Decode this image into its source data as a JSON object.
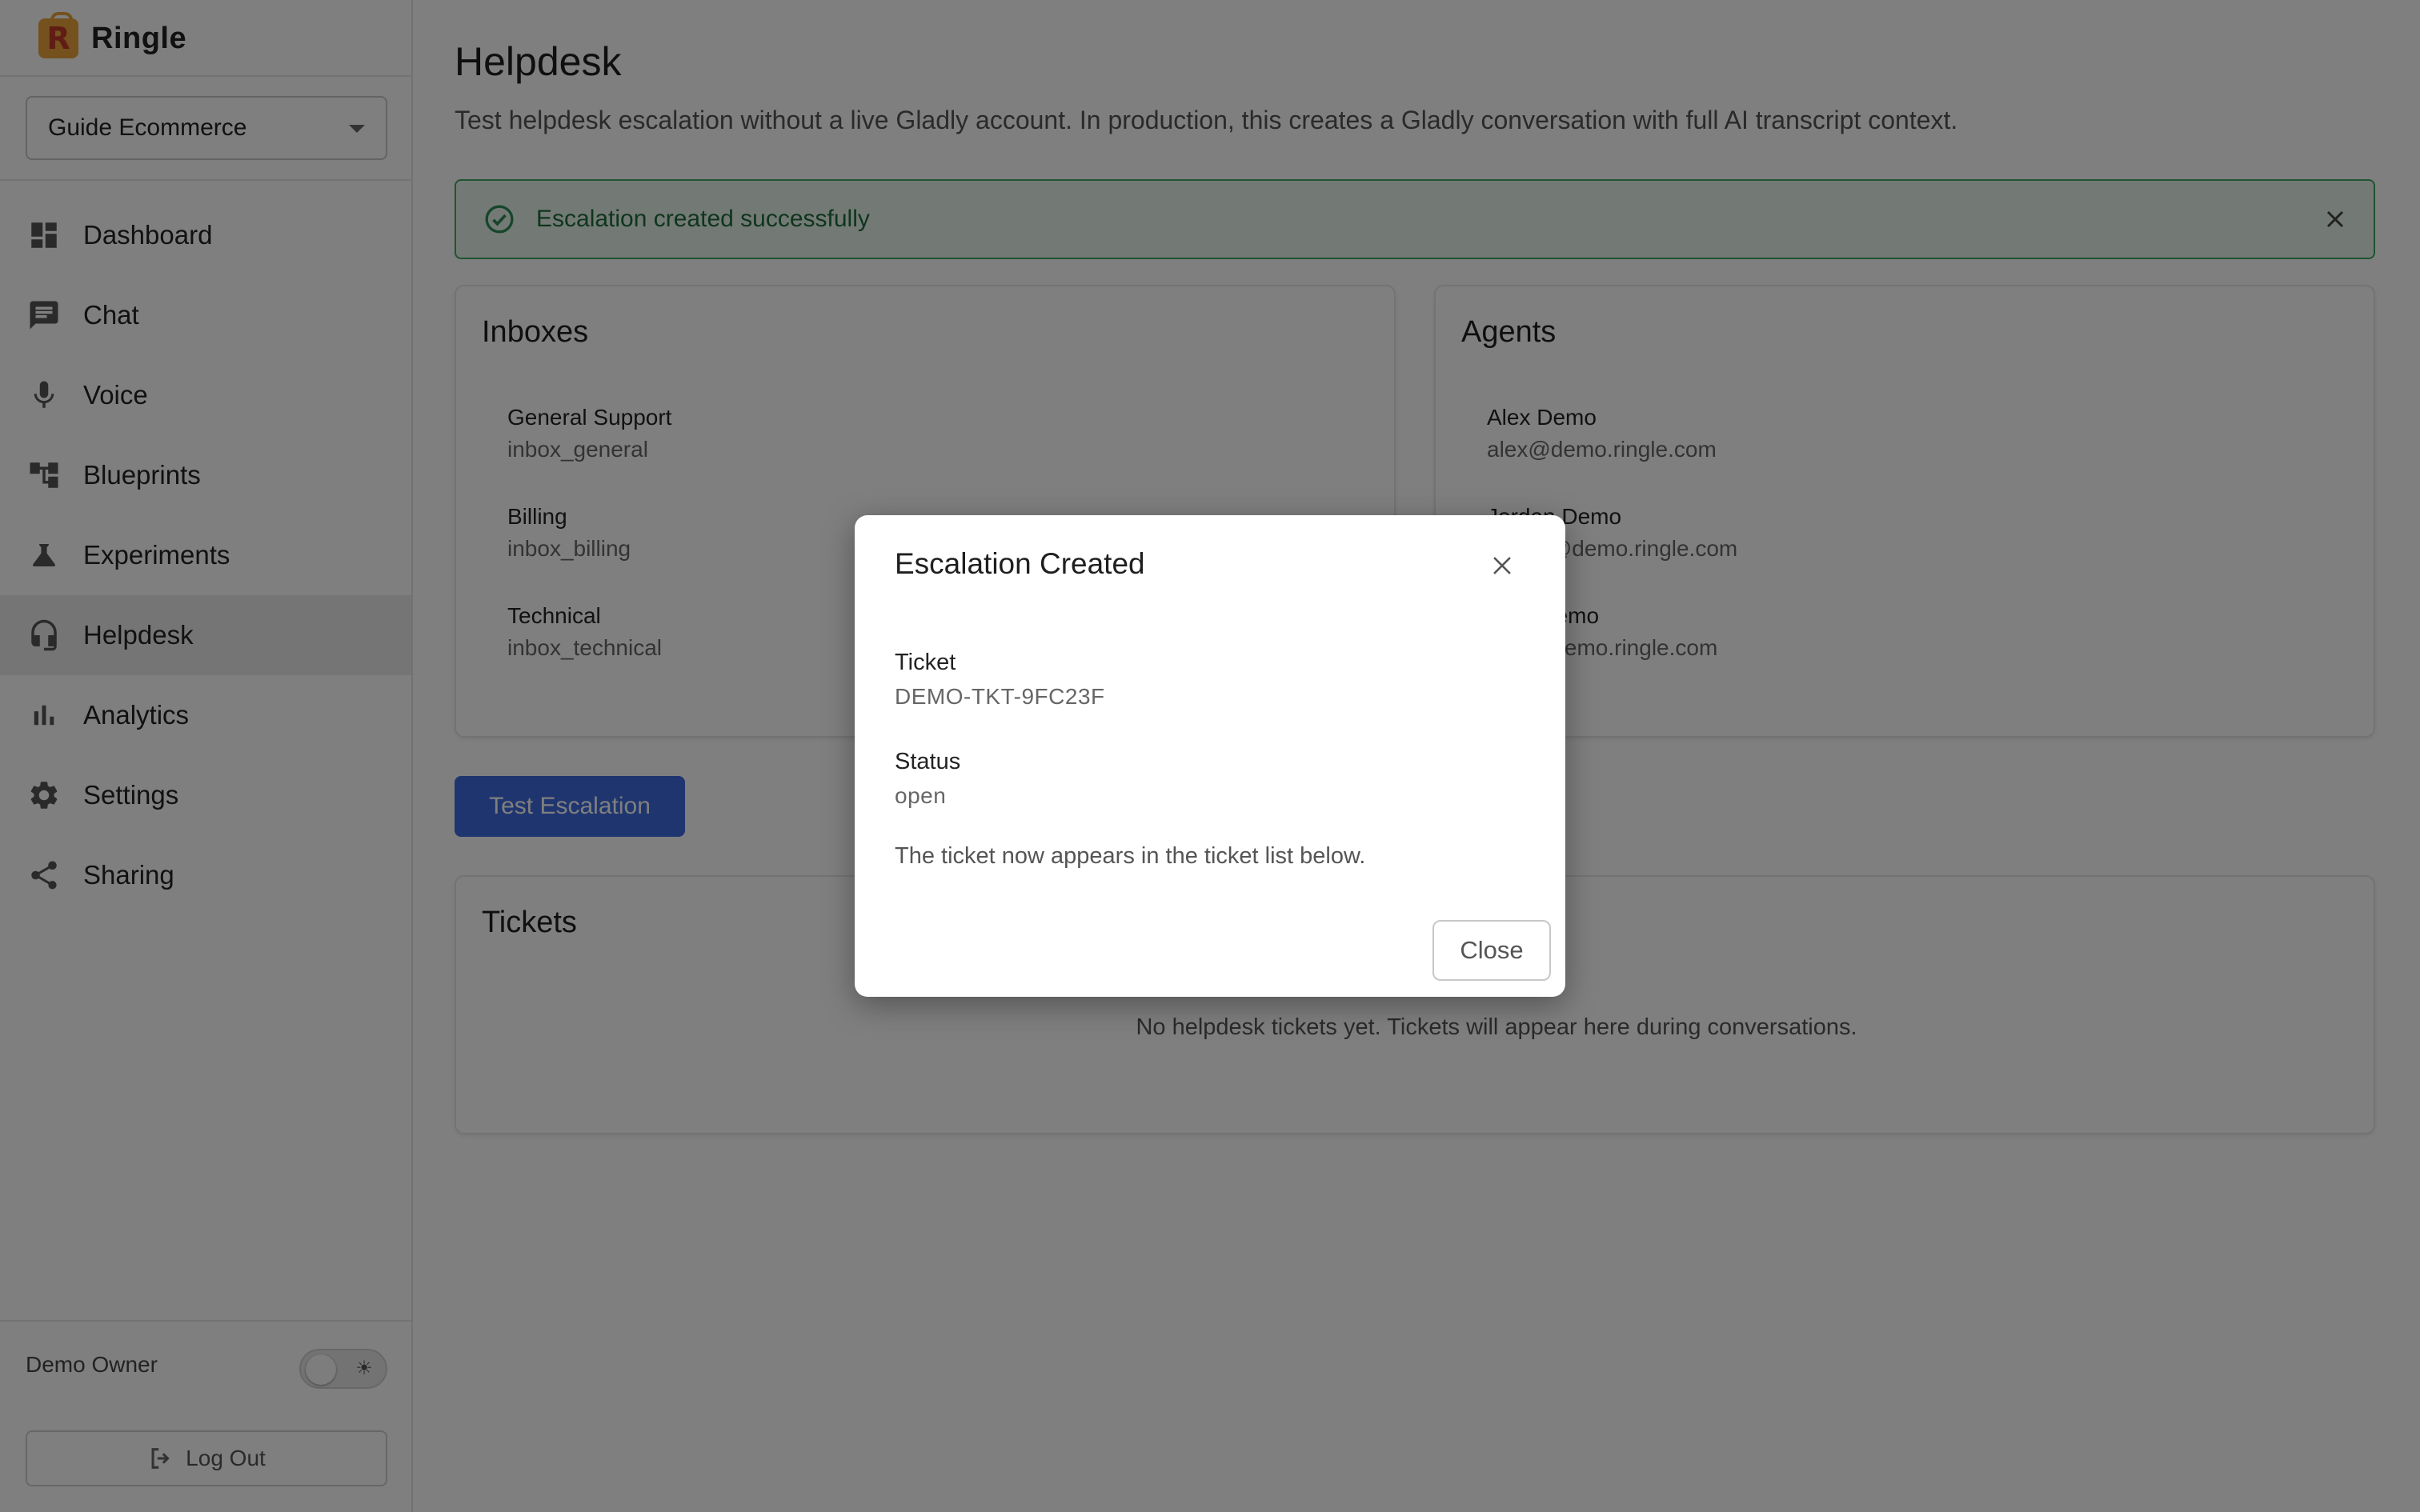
{
  "app": {
    "name": "Ringle",
    "logo_letter": "R"
  },
  "workspace": {
    "selected": "Guide Ecommerce"
  },
  "sidebar": {
    "items": [
      {
        "label": "Dashboard",
        "icon": "dashboard-icon"
      },
      {
        "label": "Chat",
        "icon": "chat-icon"
      },
      {
        "label": "Voice",
        "icon": "microphone-icon"
      },
      {
        "label": "Blueprints",
        "icon": "blueprint-icon"
      },
      {
        "label": "Experiments",
        "icon": "flask-icon"
      },
      {
        "label": "Helpdesk",
        "icon": "headset-icon",
        "active": true
      },
      {
        "label": "Analytics",
        "icon": "bar-chart-icon"
      },
      {
        "label": "Settings",
        "icon": "gear-icon"
      },
      {
        "label": "Sharing",
        "icon": "share-icon"
      }
    ],
    "user": "Demo Owner",
    "logout_label": "Log Out"
  },
  "page": {
    "title": "Helpdesk",
    "subtitle": "Test helpdesk escalation without a live Gladly account. In production, this creates a Gladly conversation with full AI transcript context."
  },
  "alert": {
    "message": "Escalation created successfully",
    "color": "#3fa864"
  },
  "inboxes": {
    "title": "Inboxes",
    "items": [
      {
        "name": "General Support",
        "id": "inbox_general"
      },
      {
        "name": "Billing",
        "id": "inbox_billing"
      },
      {
        "name": "Technical",
        "id": "inbox_technical"
      }
    ]
  },
  "agents": {
    "title": "Agents",
    "items": [
      {
        "name": "Alex Demo",
        "email": "alex@demo.ringle.com"
      },
      {
        "name": "Jordan Demo",
        "email": "jordan@demo.ringle.com"
      },
      {
        "name": "Sam Demo",
        "email": "sam@demo.ringle.com"
      }
    ]
  },
  "actions": {
    "test_escalation": "Test Escalation",
    "accent": "#3f6ae1"
  },
  "tickets": {
    "title": "Tickets",
    "empty": "No helpdesk tickets yet. Tickets will appear here during conversations."
  },
  "modal": {
    "title": "Escalation Created",
    "ticket_label": "Ticket",
    "ticket_value": "DEMO-TKT-9FC23F",
    "status_label": "Status",
    "status_value": "open",
    "note": "The ticket now appears in the ticket list below.",
    "close_label": "Close"
  }
}
